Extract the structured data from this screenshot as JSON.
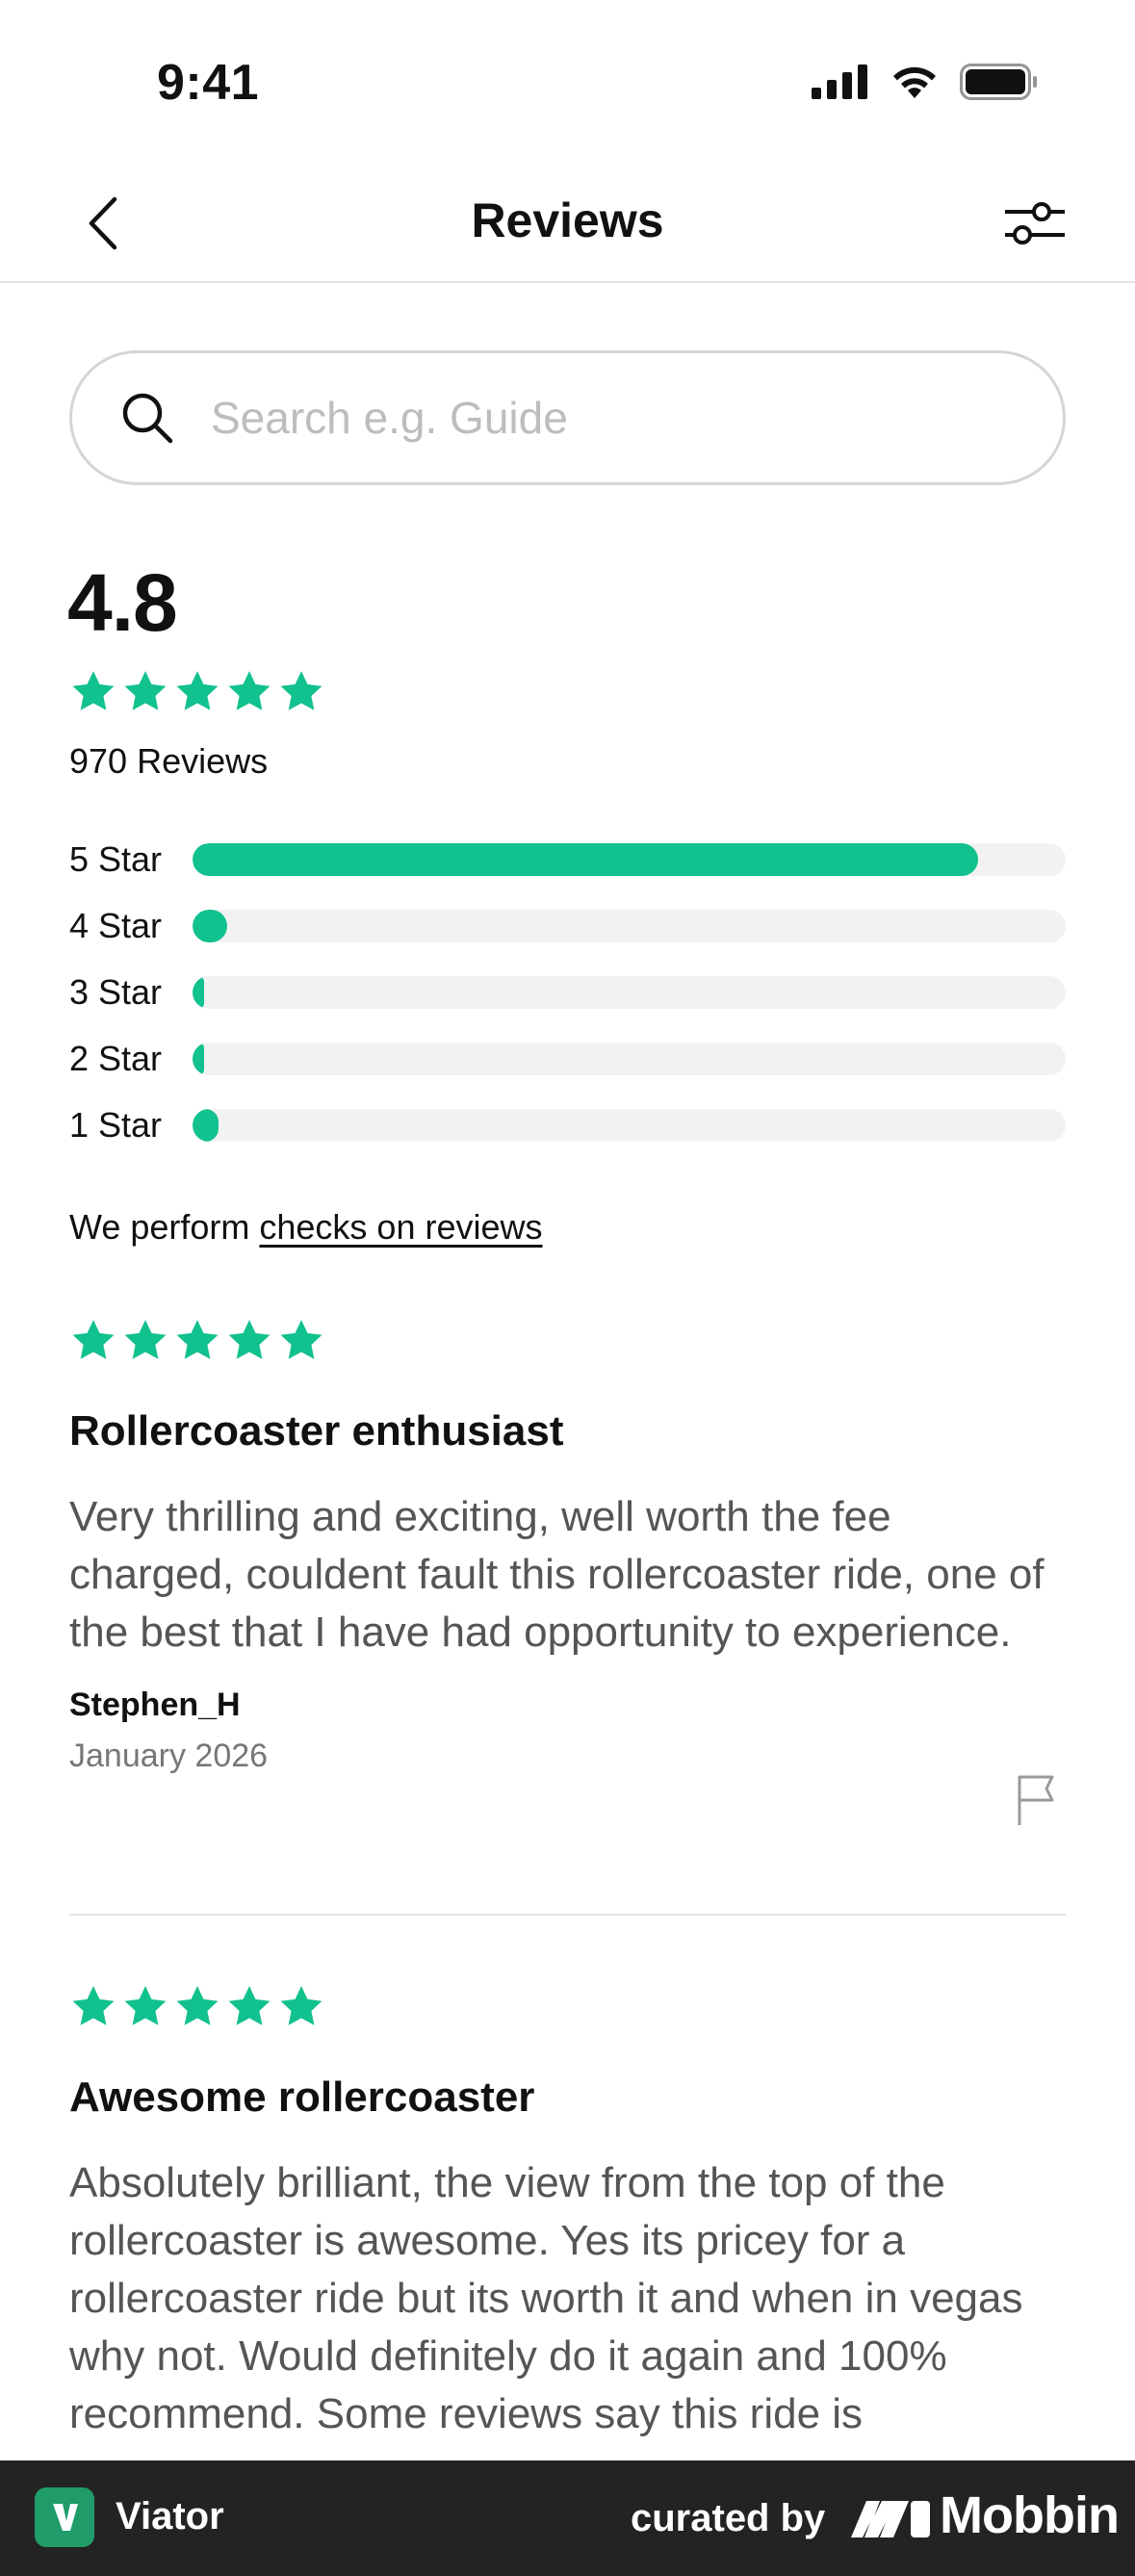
{
  "status_bar": {
    "time": "9:41"
  },
  "nav": {
    "title": "Reviews",
    "back_icon": "chevron-left-icon",
    "filter_icon": "sliders-icon"
  },
  "search": {
    "placeholder": "Search e.g. Guide",
    "value": ""
  },
  "summary": {
    "rating": "4.8",
    "stars": 5,
    "review_count": "970 Reviews",
    "breakdown": [
      {
        "label": "5 Star",
        "fraction": 0.9
      },
      {
        "label": "4 Star",
        "fraction": 0.04
      },
      {
        "label": "3 Star",
        "fraction": 0.01
      },
      {
        "label": "2 Star",
        "fraction": 0.01
      },
      {
        "label": "1 Star",
        "fraction": 0.03
      }
    ]
  },
  "checks": {
    "prefix": "We perform ",
    "link": "checks on reviews"
  },
  "reviews": [
    {
      "stars": 5,
      "title": "Rollercoaster enthusiast",
      "body": "Very thrilling and exciting, well worth the fee charged, couldent fault this rollercoaster ride, one of the best that I have had opportunity to experience.",
      "author": "Stephen_H",
      "date": "January 2026"
    },
    {
      "stars": 5,
      "title": "Awesome rollercoaster",
      "body": "Absolutely brilliant, the view from the top of the rollercoaster is awesome. Yes its pricey for a rollercoaster ride but its worth it and when in vegas why not. Would definitely do it again and 100% recommend. Some reviews say this ride is"
    }
  ],
  "footer": {
    "app_name": "Viator",
    "curated_by": "curated by",
    "brand": "Mobbin"
  },
  "colors": {
    "accent": "#11c18e",
    "track": "#f2f2f2",
    "footer_bg": "#232323"
  }
}
